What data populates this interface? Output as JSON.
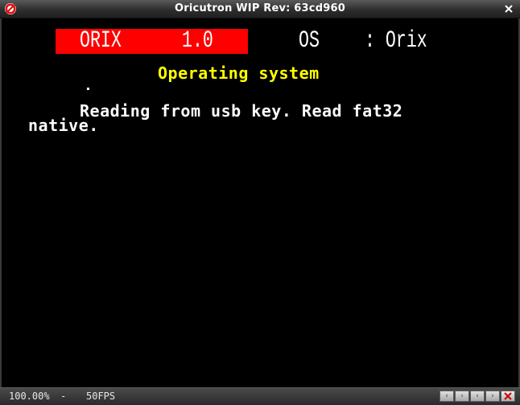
{
  "window": {
    "title": "Oricutron WIP Rev: 63cd960"
  },
  "screen": {
    "banner": {
      "name": "ORIX",
      "version": "1.0",
      "os_label": "OS",
      "os_name": ": Orix"
    },
    "subtitle": "Operating system",
    "lines": [
      "Reading from usb key. Read fat32",
      "native."
    ]
  },
  "statusbar": {
    "zoom": "100.00%",
    "separator": "-",
    "fps": "50FPS",
    "buttons": [
      "left-arrow",
      "right-arrow",
      "left-arrow",
      "right-arrow",
      "close-x"
    ]
  },
  "colors": {
    "banner_bg": "#ff0000",
    "subtitle": "#ffff00",
    "text": "#ffffff",
    "screen_bg": "#000000"
  },
  "icons": {
    "app": "oricutron-logo-icon",
    "close": "close-icon"
  }
}
